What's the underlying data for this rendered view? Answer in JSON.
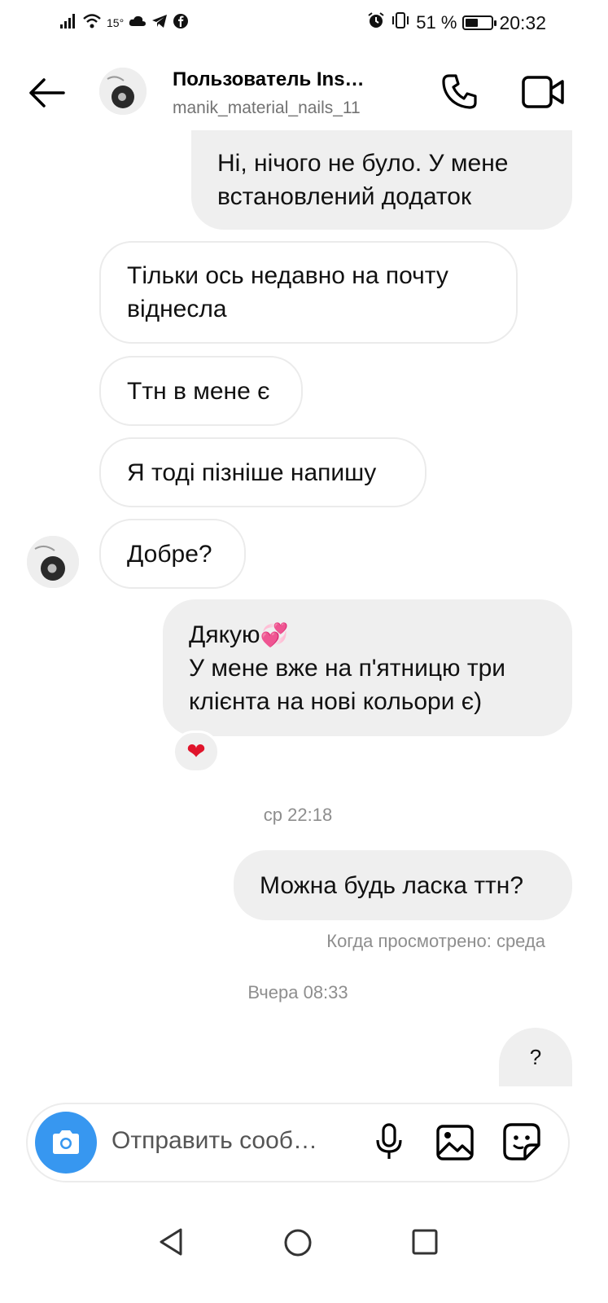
{
  "status_bar": {
    "temperature": "15°",
    "battery_percent": "51 %",
    "battery_level": 0.51,
    "time": "20:32"
  },
  "header": {
    "name": "Пользователь Ins…",
    "username": "manik_material_nails_11"
  },
  "messages": [
    {
      "id": "m1",
      "direction": "outgoing",
      "lines": [
        "Ні, нічого не було. У мене",
        "встановлений додаток"
      ]
    },
    {
      "id": "m2",
      "direction": "incoming",
      "lines": [
        "Тільки ось недавно на почту",
        "віднесла"
      ]
    },
    {
      "id": "m3",
      "direction": "incoming",
      "text": "Ттн в мене є"
    },
    {
      "id": "m4",
      "direction": "incoming",
      "text": "Я тоді пізніше напишу"
    },
    {
      "id": "m5",
      "direction": "incoming",
      "text": "Добре?"
    },
    {
      "id": "m6",
      "direction": "outgoing",
      "line1": "Дякую",
      "line1_emoji": "💞",
      "line2": "У мене вже на п'ятницю три",
      "line3": "клієнта на нові кольори є)",
      "reaction": "❤"
    },
    {
      "id": "m7",
      "direction": "outgoing",
      "text": "Можна будь ласка ттн?",
      "seen": "Когда просмотрено: среда"
    },
    {
      "id": "m8",
      "direction": "outgoing",
      "text": "?"
    }
  ],
  "timestamps": {
    "t1": "ср 22:18",
    "t2": "Вчера 08:33"
  },
  "composer": {
    "placeholder": "Отправить сооб…"
  },
  "icons": {
    "back": "arrow-left-icon",
    "call": "phone-icon",
    "video": "video-camera-icon",
    "camera": "camera-icon",
    "mic": "microphone-icon",
    "gallery": "image-icon",
    "sticker": "sticker-icon"
  },
  "colors": {
    "accent": "#3797f0",
    "outgoing_bubble": "#efefef",
    "heart": "#e0142b"
  }
}
